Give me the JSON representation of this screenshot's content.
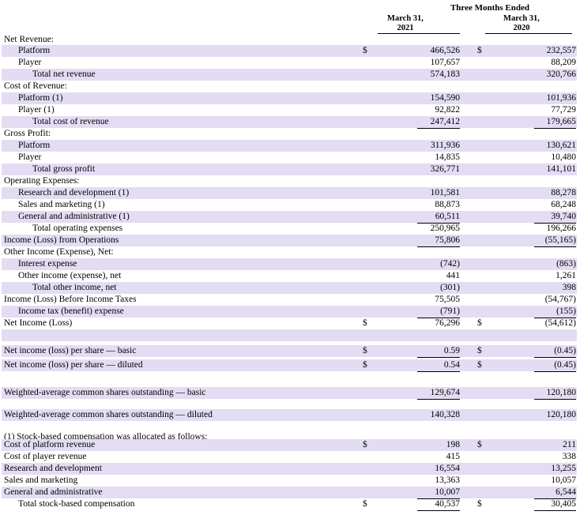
{
  "header": {
    "period": "Three Months Ended",
    "col1": [
      "March 31,",
      "2021"
    ],
    "col2": [
      "March 31,",
      "2020"
    ]
  },
  "rows": [
    {
      "label": "Net Revenue:",
      "indent": 0,
      "shade": false,
      "y": 42
    },
    {
      "label": "Platform",
      "indent": 1,
      "shade": true,
      "cur1": "$",
      "cur2": "$",
      "v1": "466,526",
      "v2": "232,557"
    },
    {
      "label": "Player",
      "indent": 1,
      "shade": false,
      "v1": "107,657",
      "v2": "88,209",
      "ul": true
    },
    {
      "label": "Total net revenue",
      "indent": 2,
      "shade": true,
      "v1": "574,183",
      "v2": "320,766"
    },
    {
      "label": "Cost of Revenue:",
      "indent": 0,
      "shade": false
    },
    {
      "label": "Platform (1)",
      "indent": 1,
      "shade": true,
      "v1": "154,590",
      "v2": "101,936"
    },
    {
      "label": "Player (1)",
      "indent": 1,
      "shade": false,
      "v1": "92,822",
      "v2": "77,729",
      "ul": true
    },
    {
      "label": "Total cost of revenue",
      "indent": 2,
      "shade": true,
      "v1": "247,412",
      "v2": "179,665",
      "ul": true
    },
    {
      "label": "Gross Profit:",
      "indent": 0,
      "shade": false
    },
    {
      "label": "Platform",
      "indent": 1,
      "shade": true,
      "v1": "311,936",
      "v2": "130,621"
    },
    {
      "label": "Player",
      "indent": 1,
      "shade": false,
      "v1": "14,835",
      "v2": "10,480",
      "ul": true
    },
    {
      "label": "Total gross profit",
      "indent": 2,
      "shade": true,
      "v1": "326,771",
      "v2": "141,101"
    },
    {
      "label": "Operating Expenses:",
      "indent": 0,
      "shade": false
    },
    {
      "label": "Research and development (1)",
      "indent": 1,
      "shade": true,
      "v1": "101,581",
      "v2": "88,278"
    },
    {
      "label": "Sales and marketing (1)",
      "indent": 1,
      "shade": false,
      "v1": "88,873",
      "v2": "68,248"
    },
    {
      "label": "General and administrative (1)",
      "indent": 1,
      "shade": true,
      "v1": "60,511",
      "v2": "39,740",
      "ul": true
    },
    {
      "label": "Total operating expenses",
      "indent": 2,
      "shade": false,
      "v1": "250,965",
      "v2": "196,266",
      "ul": true
    },
    {
      "label": "Income (Loss) from Operations",
      "indent": 0,
      "shade": true,
      "v1": "75,806",
      "v2": "(55,165)",
      "ul": true
    },
    {
      "label": "Other Income (Expense), Net:",
      "indent": 0,
      "shade": false
    },
    {
      "label": "Interest expense",
      "indent": 1,
      "shade": true,
      "v1": "(742)",
      "v2": "(863)"
    },
    {
      "label": "Other income (expense), net",
      "indent": 1,
      "shade": false,
      "v1": "441",
      "v2": "1,261",
      "ul": true
    },
    {
      "label": "Total other income, net",
      "indent": 2,
      "shade": true,
      "v1": "(301)",
      "v2": "398"
    },
    {
      "label": "Income (Loss) Before Income Taxes",
      "indent": 0,
      "shade": false,
      "v1": "75,505",
      "v2": "(54,767)"
    },
    {
      "label": "Income tax (benefit) expense",
      "indent": 1,
      "shade": true,
      "v1": "(791)",
      "v2": "(155)",
      "ul": true
    },
    {
      "label": "Net Income (Loss)",
      "indent": 0,
      "shade": false,
      "cur1": "$",
      "cur2": "$",
      "v1": "76,296",
      "v2": "(54,612)",
      "ul": true,
      "dul": true
    },
    {
      "label": "",
      "indent": 0,
      "shade": true
    },
    {
      "label": "",
      "indent": 0,
      "shade": false
    },
    {
      "label": "Net income (loss) per share — basic",
      "indent": 0,
      "shade": true,
      "cur1": "$",
      "cur2": "$",
      "v1": "0.59",
      "v2": "(0.45)",
      "ul": true
    },
    {
      "label": "",
      "indent": 0,
      "shade": false
    },
    {
      "label": "Net income (loss) per share — diluted",
      "indent": 0,
      "shade": true,
      "cur1": "$",
      "cur2": "$",
      "v1": "0.54",
      "v2": "(0.45)",
      "ul": true
    },
    {
      "label": "",
      "indent": 0,
      "shade": false
    },
    {
      "label": "",
      "indent": 0,
      "shade": false
    },
    {
      "label": "Weighted-average common shares outstanding — basic",
      "indent": 0,
      "shade": true,
      "v1": "129,674",
      "v2": "120,180",
      "ul": true
    },
    {
      "label": "",
      "indent": 0,
      "shade": false
    },
    {
      "label": "Weighted-average common shares outstanding — diluted",
      "indent": 0,
      "shade": true,
      "v1": "140,328",
      "v2": "120,180"
    },
    {
      "label": "",
      "indent": 0,
      "shade": false
    },
    {
      "label": "",
      "indent": 0,
      "shade": false
    },
    {
      "label": "(1) Stock-based compensation was allocated as follows:",
      "indent": 0,
      "shade": false
    },
    {
      "label": "Cost of platform revenue",
      "indent": 0,
      "shade": true,
      "cur1": "$",
      "cur2": "$",
      "v1": "198",
      "v2": "211"
    },
    {
      "label": "Cost of player revenue",
      "indent": 0,
      "shade": false,
      "v1": "415",
      "v2": "338"
    },
    {
      "label": "Research and development",
      "indent": 0,
      "shade": true,
      "v1": "16,554",
      "v2": "13,255"
    },
    {
      "label": "Sales and marketing",
      "indent": 0,
      "shade": false,
      "v1": "13,363",
      "v2": "10,057"
    },
    {
      "label": "General and administrative",
      "indent": 0,
      "shade": true,
      "v1": "10,007",
      "v2": "6,544",
      "ul": true
    },
    {
      "label": "Total stock-based compensation",
      "indent": 1,
      "shade": false,
      "cur1": "$",
      "cur2": "$",
      "v1": "40,537",
      "v2": "30,405",
      "ul": true
    }
  ]
}
